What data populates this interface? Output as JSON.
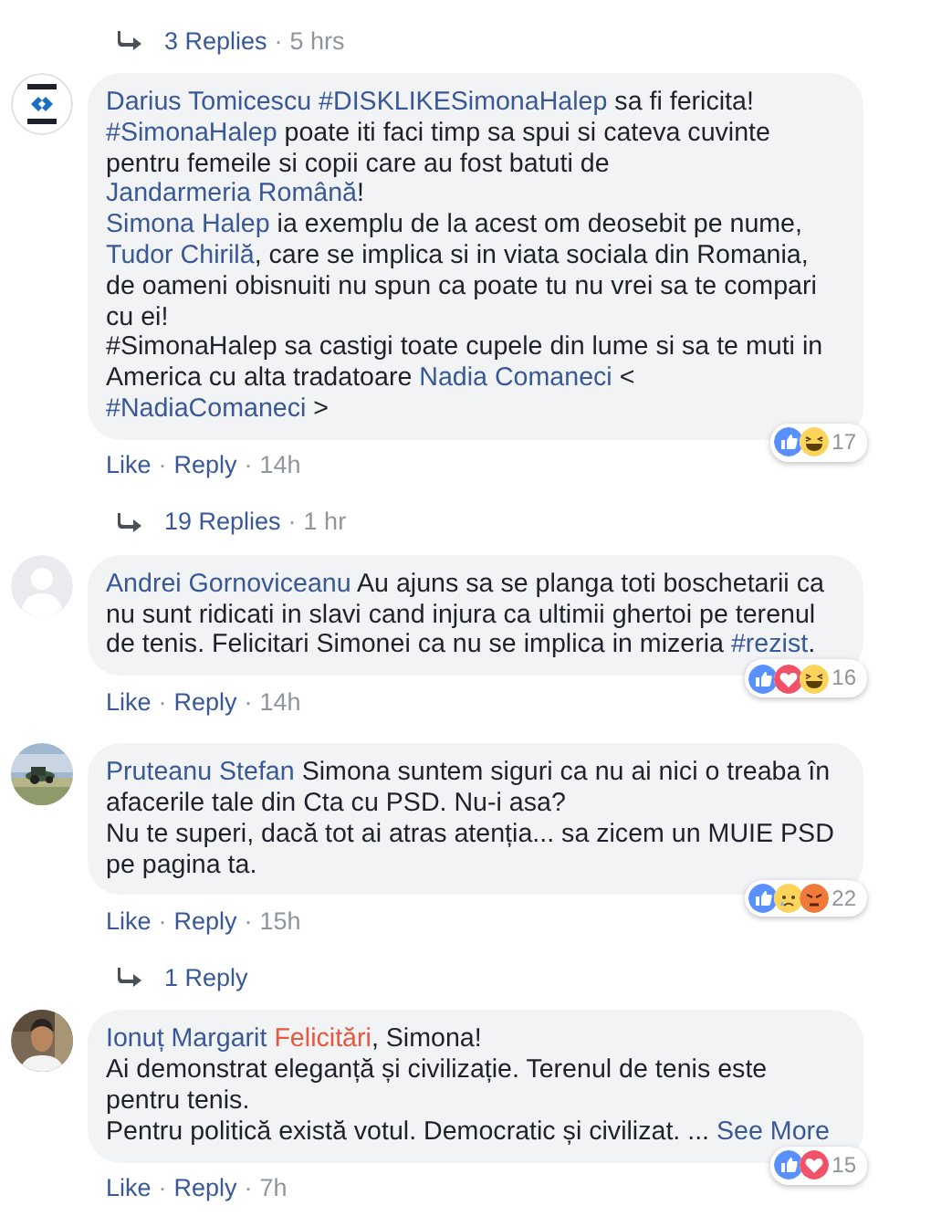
{
  "thread": [
    {
      "kind": "replies",
      "label": "3 Replies",
      "separator": "·",
      "time": "5 hrs"
    },
    {
      "kind": "comment",
      "avatar": {
        "kind": "logo"
      },
      "author": "Darius Tomicescu",
      "paragraphs": [
        [
          {
            "kind": "tag",
            "text": "#DISKLIKESimonaHalep"
          },
          {
            "kind": "text",
            "text": " sa fi fericita!"
          }
        ],
        [
          {
            "kind": "tag",
            "text": "#SimonaHalep"
          },
          {
            "kind": "text",
            "text": " poate iti faci timp sa spui si cateva cuvinte pentru femeile si copii care au fost batuti de "
          },
          {
            "kind": "mention",
            "text": "Jandarmeria Română"
          },
          {
            "kind": "text",
            "text": "!"
          }
        ],
        [
          {
            "kind": "mention",
            "text": "Simona Halep"
          },
          {
            "kind": "text",
            "text": " ia exemplu de la acest om deosebit pe nume, "
          },
          {
            "kind": "mention",
            "text": "Tudor Chirilă"
          },
          {
            "kind": "text",
            "text": ", care se implica si in viata sociala din Romania, de oameni obisnuiti nu spun ca poate tu nu vrei sa te compari cu ei!"
          }
        ],
        [
          {
            "kind": "text",
            "text": "#SimonaHalep sa castigi toate cupele din lume si sa te muti in America cu alta tradatoare "
          },
          {
            "kind": "mention",
            "text": "Nadia Comaneci"
          },
          {
            "kind": "text",
            "text": " < "
          },
          {
            "kind": "tag",
            "text": "#NadiaComaneci"
          },
          {
            "kind": "text",
            "text": " >"
          }
        ]
      ],
      "reactions": [
        {
          "kind": "like"
        },
        {
          "kind": "haha"
        }
      ],
      "reaction_count": "17",
      "like": "Like",
      "separator_1": "·",
      "reply": "Reply",
      "separator_2": "·",
      "time": "14h"
    },
    {
      "kind": "replies",
      "label": "19 Replies",
      "separator": "·",
      "time": "1 hr"
    },
    {
      "kind": "comment",
      "avatar": {
        "kind": "default"
      },
      "author": "Andrei Gornoviceanu",
      "paragraphs": [
        [
          {
            "kind": "text",
            "text": " Au ajuns sa se planga toti boschetarii ca nu sunt ridicati in slavi cand injura ca ultimii ghertoi pe terenul de tenis. Felicitari Simonei ca nu se implica in mizeria "
          },
          {
            "kind": "tag",
            "text": "#rezist"
          },
          {
            "kind": "text",
            "text": "."
          }
        ]
      ],
      "reactions": [
        {
          "kind": "like"
        },
        {
          "kind": "love"
        },
        {
          "kind": "haha"
        }
      ],
      "reaction_count": "16",
      "like": "Like",
      "separator_1": "·",
      "reply": "Reply",
      "separator_2": "·",
      "time": "14h"
    },
    {
      "kind": "comment",
      "avatar": {
        "kind": "picture"
      },
      "author": "Pruteanu Stefan",
      "paragraphs": [
        [
          {
            "kind": "text",
            "text": " Simona suntem siguri ca nu ai nici o treaba în afacerile tale din Cta cu PSD. Nu-i asa?"
          }
        ],
        [
          {
            "kind": "text",
            "text": "Nu te superi, dacă tot ai atras atenția... sa zicem un MUIE PSD pe pagina ta."
          }
        ]
      ],
      "reactions": [
        {
          "kind": "like"
        },
        {
          "kind": "sad"
        },
        {
          "kind": "angry"
        }
      ],
      "reaction_count": "22",
      "like": "Like",
      "separator_1": "·",
      "reply": "Reply",
      "separator_2": "·",
      "time": "15h"
    },
    {
      "kind": "replies",
      "label": "1 Reply"
    },
    {
      "kind": "comment",
      "avatar": {
        "kind": "person"
      },
      "author": "Ionuț Margarit",
      "paragraphs": [
        [
          {
            "kind": "highlight",
            "text": "Felicitări"
          },
          {
            "kind": "text",
            "text": ", Simona!"
          }
        ],
        [
          {
            "kind": "text",
            "text": "Ai demonstrat eleganță și civilizație. Terenul de tenis este pentru tenis."
          }
        ],
        [
          {
            "kind": "text",
            "text": "Pentru politică există votul. Democratic și civilizat. ... "
          },
          {
            "kind": "more",
            "text": "See More"
          }
        ]
      ],
      "reactions": [
        {
          "kind": "like"
        },
        {
          "kind": "love"
        }
      ],
      "reaction_count": "15",
      "like": "Like",
      "separator_1": "·",
      "reply": "Reply",
      "separator_2": "·",
      "time": "7h"
    }
  ]
}
